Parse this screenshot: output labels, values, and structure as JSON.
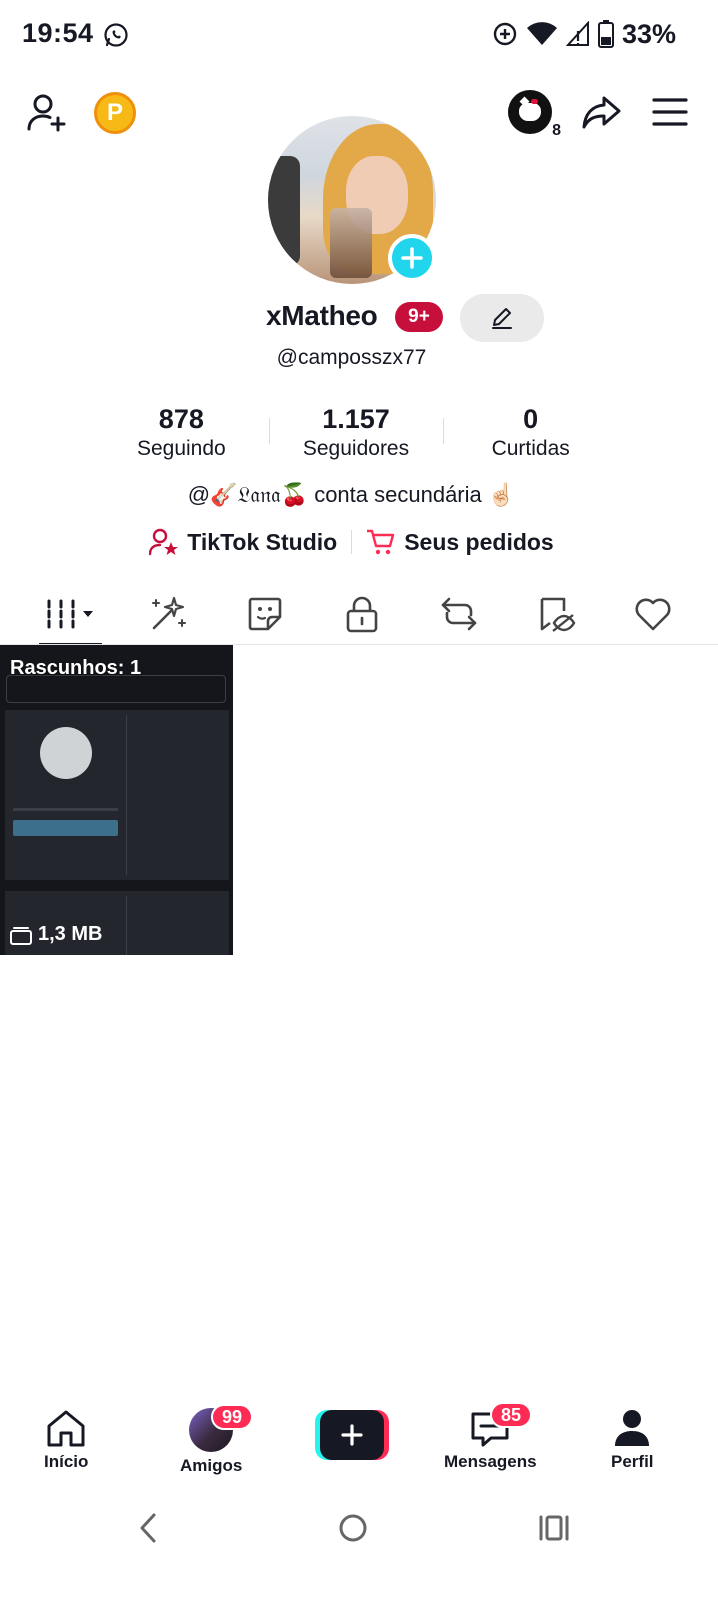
{
  "status_bar": {
    "time": "19:54",
    "battery": "33%",
    "icons": [
      "whatsapp-icon",
      "data-saver-icon",
      "wifi-icon",
      "signal-icon",
      "battery-icon"
    ]
  },
  "top_bar": {
    "left_icons": [
      "add-friend-icon",
      "coin-icon"
    ],
    "coin_label": "P",
    "story_count": "8",
    "right_icons": [
      "share-icon",
      "menu-icon"
    ]
  },
  "profile": {
    "username": "xMatheo",
    "badge": "9+",
    "handle": "@camposszx77",
    "stats": [
      {
        "value": "878",
        "label": "Seguindo"
      },
      {
        "value": "1.157",
        "label": "Seguidores"
      },
      {
        "value": "0",
        "label": "Curtidas"
      }
    ],
    "bio": "@🎸𝔏𝔞𝔫𝔞🍒 conta secundária ☝🏻",
    "links": [
      {
        "label": "TikTok Studio",
        "icon": "creator-icon"
      },
      {
        "label": "Seus pedidos",
        "icon": "cart-icon"
      }
    ]
  },
  "tabs": [
    {
      "name": "videos",
      "icon": "grid-icon",
      "active": true
    },
    {
      "name": "effects",
      "icon": "sparkle-icon"
    },
    {
      "name": "stickers",
      "icon": "sticker-icon"
    },
    {
      "name": "private",
      "icon": "lock-icon"
    },
    {
      "name": "reposts",
      "icon": "repost-icon"
    },
    {
      "name": "favorites",
      "icon": "bookmark-eye-icon"
    },
    {
      "name": "liked",
      "icon": "heart-icon"
    }
  ],
  "drafts": {
    "title": "Rascunhos: 1",
    "size": "1,3 MB"
  },
  "bottom_nav": {
    "items": [
      {
        "label": "Início",
        "icon": "home-icon"
      },
      {
        "label": "Amigos",
        "icon": "friends-avatar",
        "badge": "99"
      },
      {
        "label": "",
        "icon": "create-icon"
      },
      {
        "label": "Mensagens",
        "icon": "inbox-icon",
        "badge": "85"
      },
      {
        "label": "Perfil",
        "icon": "profile-icon"
      }
    ]
  },
  "colors": {
    "accent_pink": "#fe2c55",
    "accent_cyan": "#25f4ee",
    "badge_red": "#c6103b",
    "add_blue": "#20d5ec",
    "coin_gold": "#f6b915",
    "text_dark": "#161823"
  }
}
